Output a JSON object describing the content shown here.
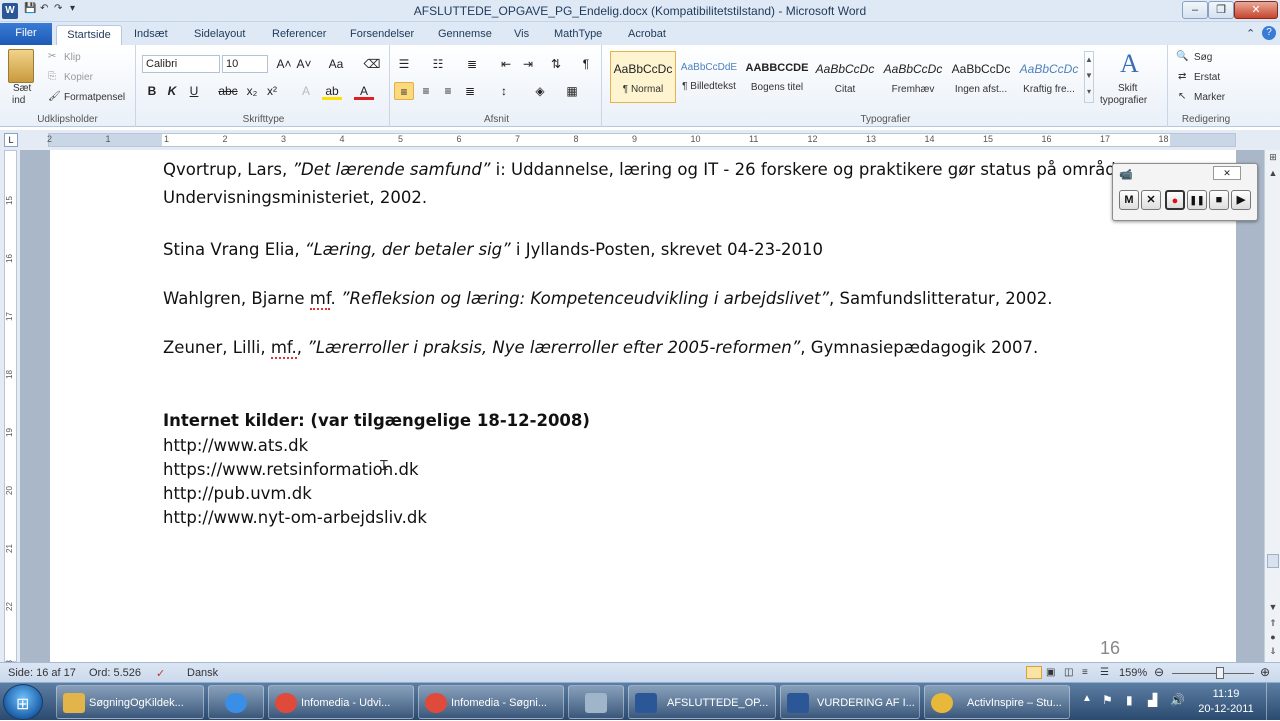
{
  "window": {
    "title": "AFSLUTTEDE_OPGAVE_PG_Endelig.docx (Kompatibilitetstilstand)  -  Microsoft Word",
    "app_icon": "W",
    "minimize": "–",
    "maximize": "❐",
    "close": "✕"
  },
  "tabs": [
    "Filer",
    "Startside",
    "Indsæt",
    "Sidelayout",
    "Referencer",
    "Forsendelser",
    "Gennemse",
    "Vis",
    "MathType",
    "Acrobat"
  ],
  "ribbon": {
    "clipboard": {
      "label": "Udklipsholder",
      "paste": "Sæt",
      "paste2": "ind",
      "cut": "Klip",
      "copy": "Kopier",
      "format_painter": "Formatpensel"
    },
    "font": {
      "label": "Skrifttype",
      "font_name": "Calibri",
      "font_size": "10"
    },
    "paragraph": {
      "label": "Afsnit"
    },
    "styles": {
      "label": "Typografier",
      "items": [
        {
          "preview": "AaBbCcDc",
          "name": "¶ Normal"
        },
        {
          "preview": "AaBbCcDdE",
          "name": "¶ Billedtekst"
        },
        {
          "preview": "AABBCCDE",
          "name": "Bogens titel"
        },
        {
          "preview": "AaBbCcDc",
          "name": "Citat"
        },
        {
          "preview": "AaBbCcDc",
          "name": "Fremhæv"
        },
        {
          "preview": "AaBbCcDc",
          "name": "Ingen afst..."
        },
        {
          "preview": "AaBbCcDc",
          "name": "Kraftig fre..."
        }
      ],
      "change_styles": "Skift",
      "change_styles2": "typografier"
    },
    "editing": {
      "label": "Redigering",
      "find": "Søg",
      "replace": "Erstat",
      "select": "Marker"
    }
  },
  "ruler": {
    "h_numbers": [
      "2",
      "1",
      "1",
      "2",
      "3",
      "4",
      "5",
      "6",
      "7",
      "8",
      "9",
      "10",
      "11",
      "12",
      "13",
      "14",
      "15",
      "16",
      "17",
      "18"
    ],
    "v_numbers": [
      "15",
      "16",
      "17",
      "18",
      "19",
      "20",
      "21",
      "22",
      "23"
    ]
  },
  "document": {
    "lines": [
      {
        "a": "Qvortrup, Lars, ",
        "i": "”Det lærende samfund”",
        "b": " i: Uddannelse, læring og IT - 26 forskere og praktikere gør status på området,"
      },
      {
        "a": "Undervisningsministeriet, 2002.",
        "i": "",
        "b": ""
      },
      {
        "a": "Stina Vrang Elia, ",
        "i": "“Læring, der betaler sig”",
        "b": " i Jyllands-Posten, skrevet 04-23-2010"
      },
      {
        "a": " Wahlgren, Bjarne ",
        "sq": "mf",
        "a2": ". ",
        "i": "”Refleksion og læring: Kompetenceudvikling i arbejdslivet”",
        "b": ", Samfundslitteratur, 2002."
      },
      {
        "a": " Zeuner, Lilli, ",
        "sq": "mf.",
        "a2": ", ",
        "i": "”Lærerroller i praksis, Nye lærerroller efter 2005-reformen”",
        "b": ", Gymnasiepædagogik 2007."
      }
    ],
    "internet_heading": "Internet kilder: (var tilgængelige 18-12-2008)",
    "links": [
      "http://www.ats.dk",
      "https://www.retsinformation.dk",
      "http://pub.uvm.dk",
      "http://www.nyt-om-arbejdsliv.dk"
    ],
    "page_number": "16"
  },
  "recorder": {
    "buttons": [
      "M",
      "✕",
      "●",
      "❚❚",
      "■",
      "▶"
    ]
  },
  "statusbar": {
    "page": "Side: 16 af 17",
    "words": "Ord: 5.526",
    "language": "Dansk",
    "zoom": "159%"
  },
  "taskbar": {
    "buttons": [
      {
        "label": "SøgningOgKildek...",
        "icon": "folder-icon",
        "color": "#e3b44a"
      },
      {
        "label": "",
        "icon": "ie-icon",
        "color": "#3a8ee6"
      },
      {
        "label": "Infomedia - Udvi...",
        "icon": "chrome-icon",
        "color": "#e04a3a"
      },
      {
        "label": "Infomedia - Søgni...",
        "icon": "chrome-icon",
        "color": "#e04a3a"
      },
      {
        "label": "",
        "icon": "calculator-icon",
        "color": "#9fb5c9"
      },
      {
        "label": "AFSLUTTEDE_OP...",
        "icon": "word-icon",
        "color": "#2b5797"
      },
      {
        "label": "VURDERING AF I...",
        "icon": "word-icon",
        "color": "#2b5797"
      },
      {
        "label": "ActivInspire – Stu...",
        "icon": "activinspire-icon",
        "color": "#e8b83a"
      }
    ],
    "time": "11:19",
    "date": "20-12-2011"
  }
}
